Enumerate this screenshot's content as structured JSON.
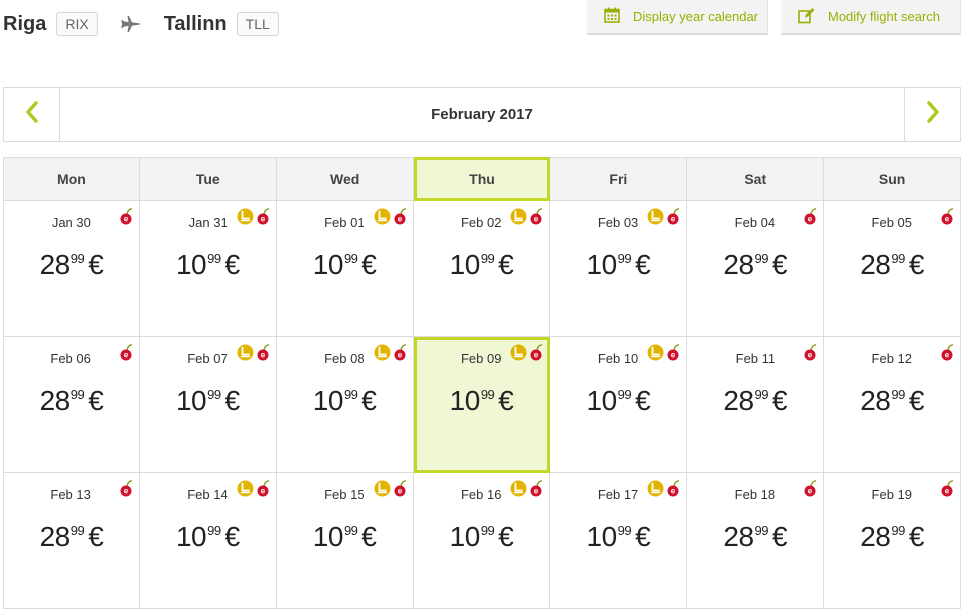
{
  "route": {
    "from_city": "Riga",
    "from_code": "RIX",
    "to_city": "Tallinn",
    "to_code": "TLL"
  },
  "toolbar": {
    "year_calendar_label": "Display year calendar",
    "modify_search_label": "Modify flight search"
  },
  "calendar": {
    "month_title": "February 2017",
    "currency": "€",
    "weekdays": [
      "Mon",
      "Tue",
      "Wed",
      "Thu",
      "Fri",
      "Sat",
      "Sun"
    ],
    "highlight_color": "#c5d62b",
    "rows": [
      [
        {
          "date": "Jan 30",
          "int": "28",
          "cents": "99",
          "seat": false
        },
        {
          "date": "Jan 31",
          "int": "10",
          "cents": "99",
          "seat": true
        },
        {
          "date": "Feb 01",
          "int": "10",
          "cents": "99",
          "seat": true
        },
        {
          "date": "Feb 02",
          "int": "10",
          "cents": "99",
          "seat": true
        },
        {
          "date": "Feb 03",
          "int": "10",
          "cents": "99",
          "seat": true
        },
        {
          "date": "Feb 04",
          "int": "28",
          "cents": "99",
          "seat": false
        },
        {
          "date": "Feb 05",
          "int": "28",
          "cents": "99",
          "seat": false
        }
      ],
      [
        {
          "date": "Feb 06",
          "int": "28",
          "cents": "99",
          "seat": false
        },
        {
          "date": "Feb 07",
          "int": "10",
          "cents": "99",
          "seat": true
        },
        {
          "date": "Feb 08",
          "int": "10",
          "cents": "99",
          "seat": true
        },
        {
          "date": "Feb 09",
          "int": "10",
          "cents": "99",
          "seat": true,
          "selected": true
        },
        {
          "date": "Feb 10",
          "int": "10",
          "cents": "99",
          "seat": true
        },
        {
          "date": "Feb 11",
          "int": "28",
          "cents": "99",
          "seat": false
        },
        {
          "date": "Feb 12",
          "int": "28",
          "cents": "99",
          "seat": false
        }
      ],
      [
        {
          "date": "Feb 13",
          "int": "28",
          "cents": "99",
          "seat": false
        },
        {
          "date": "Feb 14",
          "int": "10",
          "cents": "99",
          "seat": true
        },
        {
          "date": "Feb 15",
          "int": "10",
          "cents": "99",
          "seat": true
        },
        {
          "date": "Feb 16",
          "int": "10",
          "cents": "99",
          "seat": true
        },
        {
          "date": "Feb 17",
          "int": "10",
          "cents": "99",
          "seat": true
        },
        {
          "date": "Feb 18",
          "int": "28",
          "cents": "99",
          "seat": false
        },
        {
          "date": "Feb 19",
          "int": "28",
          "cents": "99",
          "seat": false
        }
      ]
    ]
  }
}
